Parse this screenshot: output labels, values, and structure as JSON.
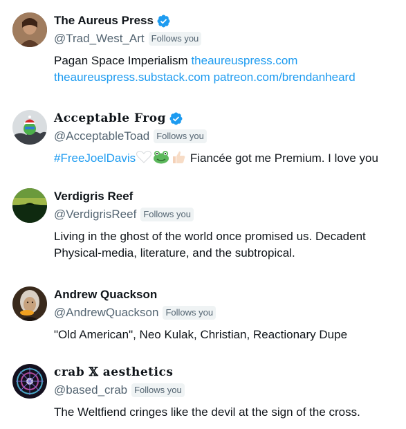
{
  "colors": {
    "link": "#1d9bf0",
    "verified": "#1d9bf0",
    "text": "#0f1419",
    "secondary": "#536471",
    "badge_bg": "#eff3f4"
  },
  "users": [
    {
      "name": "The Aureus Press",
      "verified": true,
      "handle": "@Trad_West_Art",
      "follows_label": "Follows you",
      "bio_text": "Pagan Space Imperialism ",
      "bio_link1": "theaureuspress.com",
      "bio_link2": "theaureuspress.substack.com",
      "bio_link3": "patreon.com/brendanheard"
    },
    {
      "name": "Acceptable Frog",
      "verified": true,
      "handle": "@AcceptableToad",
      "follows_label": "Follows you",
      "bio_hashtag": "#FreeJoelDavis",
      "bio_emojis": [
        "white-heart-emoji",
        "frog-emoji",
        "thumbs-up-emoji"
      ],
      "bio_text": " Fiancée got me Premium. I love you"
    },
    {
      "name": "Verdigris Reef",
      "verified": false,
      "handle": "@VerdigrisReef",
      "follows_label": "Follows you",
      "bio_line1": "Living in the ghost of the world once promised us. Decadent",
      "bio_line2": "Physical-media, literature, and the subtropical."
    },
    {
      "name": "Andrew Quackson",
      "verified": false,
      "handle": "@AndrewQuackson",
      "follows_label": "Follows you",
      "bio_line1": "\"Old American\", Neo Kulak, Christian, Reactionary Dupe"
    },
    {
      "name": "crab 𝕏 aesthetics",
      "verified": false,
      "handle": "@based_crab",
      "follows_label": "Follows you",
      "bio_line1": "The Weltfiend cringes like the devil at the sign of the cross."
    }
  ]
}
